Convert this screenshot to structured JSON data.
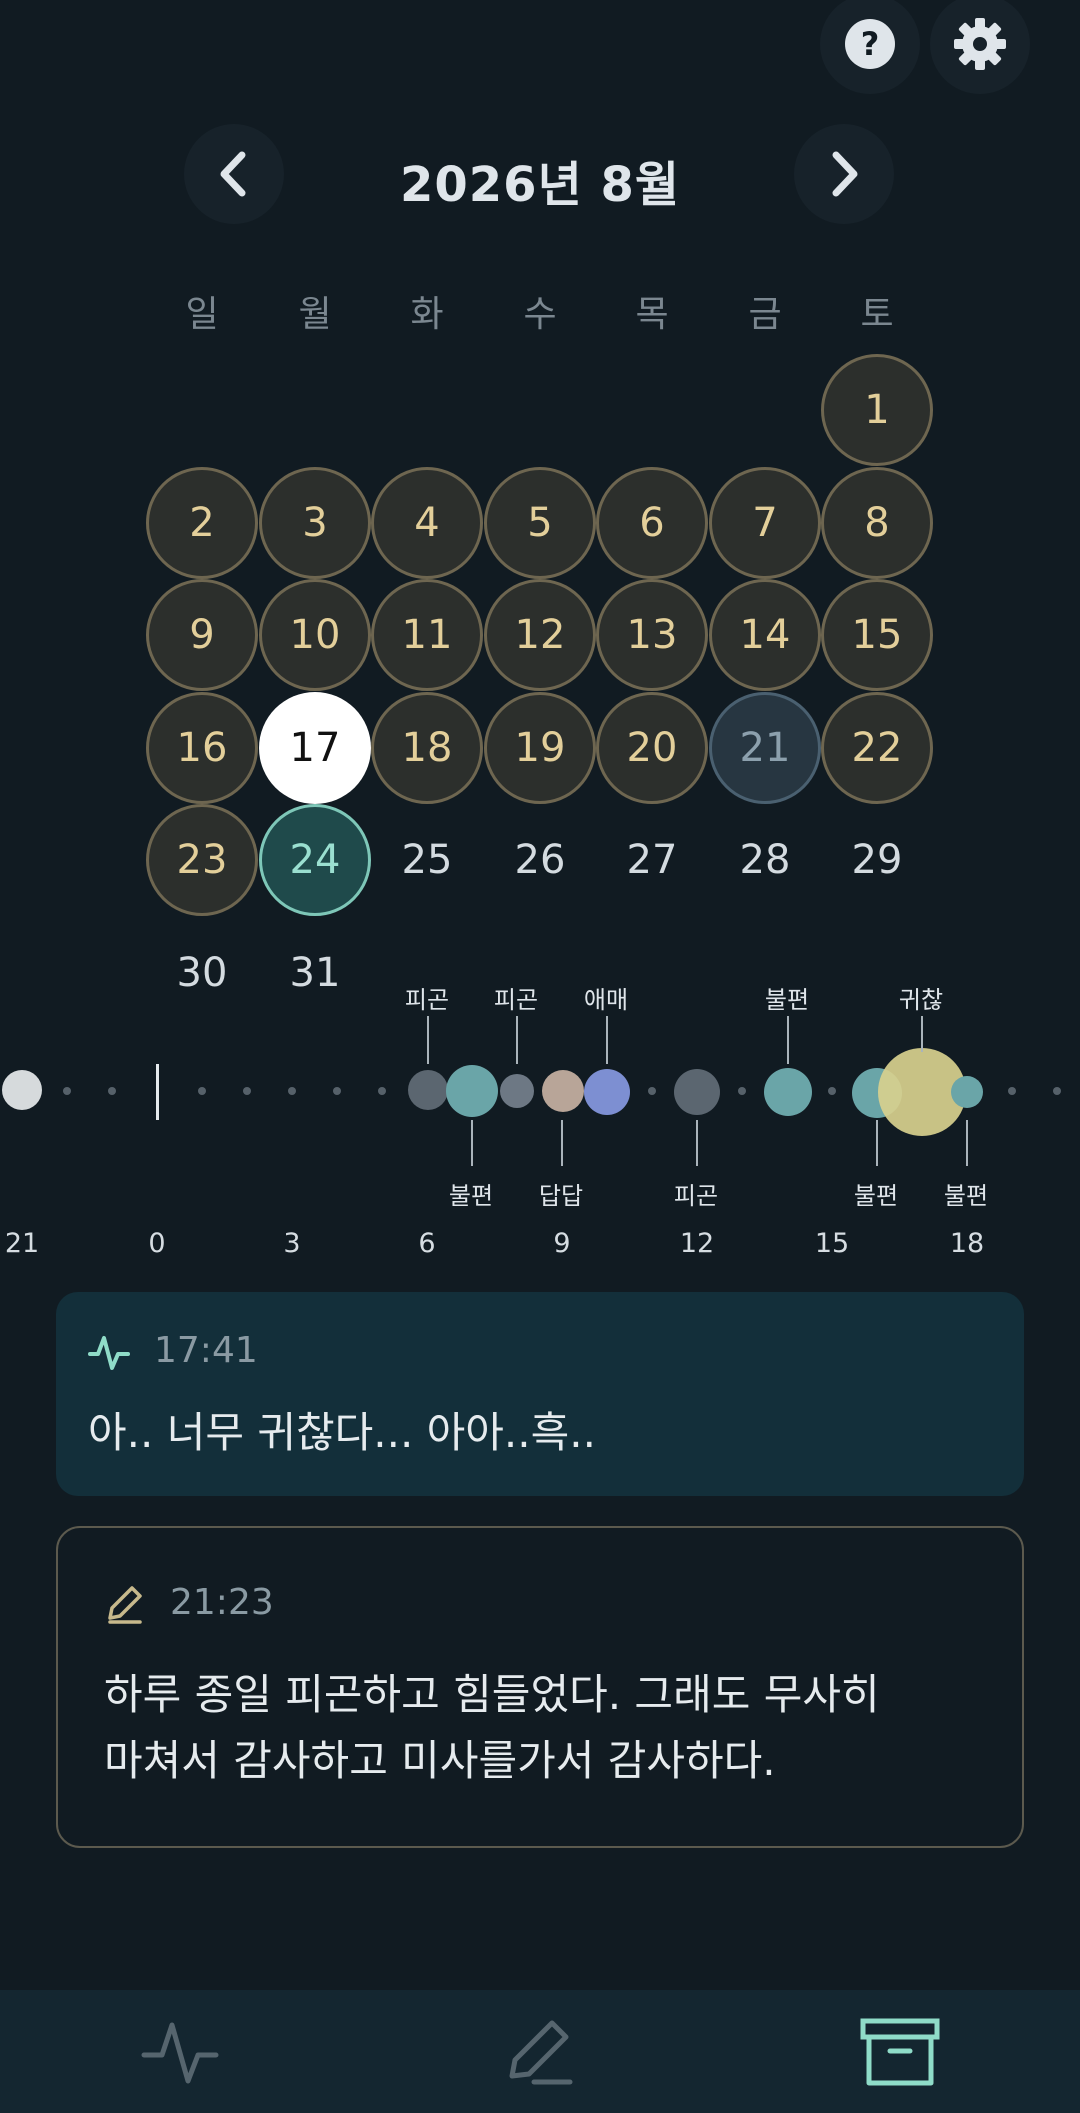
{
  "header": {
    "month_title": "2026년 8월",
    "help_icon": "help-icon",
    "settings_icon": "gear-icon"
  },
  "weekdays": [
    "일",
    "월",
    "화",
    "수",
    "목",
    "금",
    "토"
  ],
  "days": {
    "d1": "1",
    "d2": "2",
    "d3": "3",
    "d4": "4",
    "d5": "5",
    "d6": "6",
    "d7": "7",
    "d8": "8",
    "d9": "9",
    "d10": "10",
    "d11": "11",
    "d12": "12",
    "d13": "13",
    "d14": "14",
    "d15": "15",
    "d16": "16",
    "d17": "17",
    "d18": "18",
    "d19": "19",
    "d20": "20",
    "d21": "21",
    "d22": "22",
    "d23": "23",
    "d24": "24",
    "d25": "25",
    "d26": "26",
    "d27": "27",
    "d28": "28",
    "d29": "29",
    "d30": "30",
    "d31": "31"
  },
  "timeline": {
    "tags_top": [
      "피곤",
      "피곤",
      "애매",
      "불편",
      "귀찮"
    ],
    "tags_bottom": [
      "불편",
      "답답",
      "피곤",
      "불편",
      "불편"
    ],
    "hours": [
      "21",
      "0",
      "3",
      "6",
      "9",
      "12",
      "15",
      "18"
    ]
  },
  "mood_card": {
    "icon": "activity-icon",
    "time": "17:41",
    "text": "아.. 너무 귀찮다... 아아..흑.."
  },
  "diary_card": {
    "icon": "pencil-icon",
    "time": "21:23",
    "text_line1": "하루 종일 피곤하고 힘들었다. 그래도 무사히",
    "text_line2": "마쳐서 감사하고 미사를가서 감사하다."
  },
  "bottom_nav": {
    "items": [
      "activity-icon",
      "pencil-icon",
      "archive-icon"
    ],
    "active": "archive-icon"
  },
  "colors": {
    "background": "#111b22",
    "gold": "#e3cf9a",
    "teal": "#7ec7b8",
    "mood_card": "#132f3a"
  }
}
